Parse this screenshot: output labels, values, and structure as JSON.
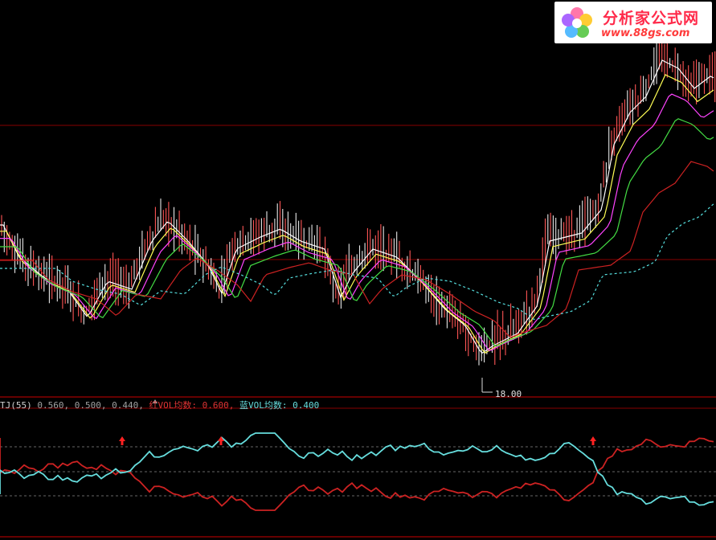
{
  "logo": {
    "name": "分析家公式网",
    "url": "www.88gs.com"
  },
  "indicator": {
    "name": "TJ(55)",
    "values": "0.560, 0.500, 0.440,",
    "red_label": "红VOL均数:",
    "red_value": "0.600,",
    "blue_label": "蓝VOL均数:",
    "blue_value": "0.400"
  },
  "low_marker": {
    "label": "18.00"
  },
  "colors": {
    "background": "#000000",
    "up_candle": "#ff5555",
    "down_candle": "#e8e8e8",
    "ma_white": "#ffffff",
    "ma_yellow": "#ffff55",
    "ma_magenta": "#ff44ff",
    "ma_green": "#44dd44",
    "ma_red": "#cc2222",
    "ma_cyan_dotted": "#55dddd",
    "red_vol_line": "#cc2222",
    "blue_vol_line": "#66dddd",
    "separator": "#880000"
  },
  "chart_data": {
    "type": "line",
    "panels": [
      "price",
      "indicator"
    ],
    "price_low": 18.0,
    "indicator_levels": [
      0.56,
      0.5,
      0.44
    ],
    "red_vol_avg": 0.6,
    "blue_vol_avg": 0.4,
    "up_arrow_count": 3
  }
}
